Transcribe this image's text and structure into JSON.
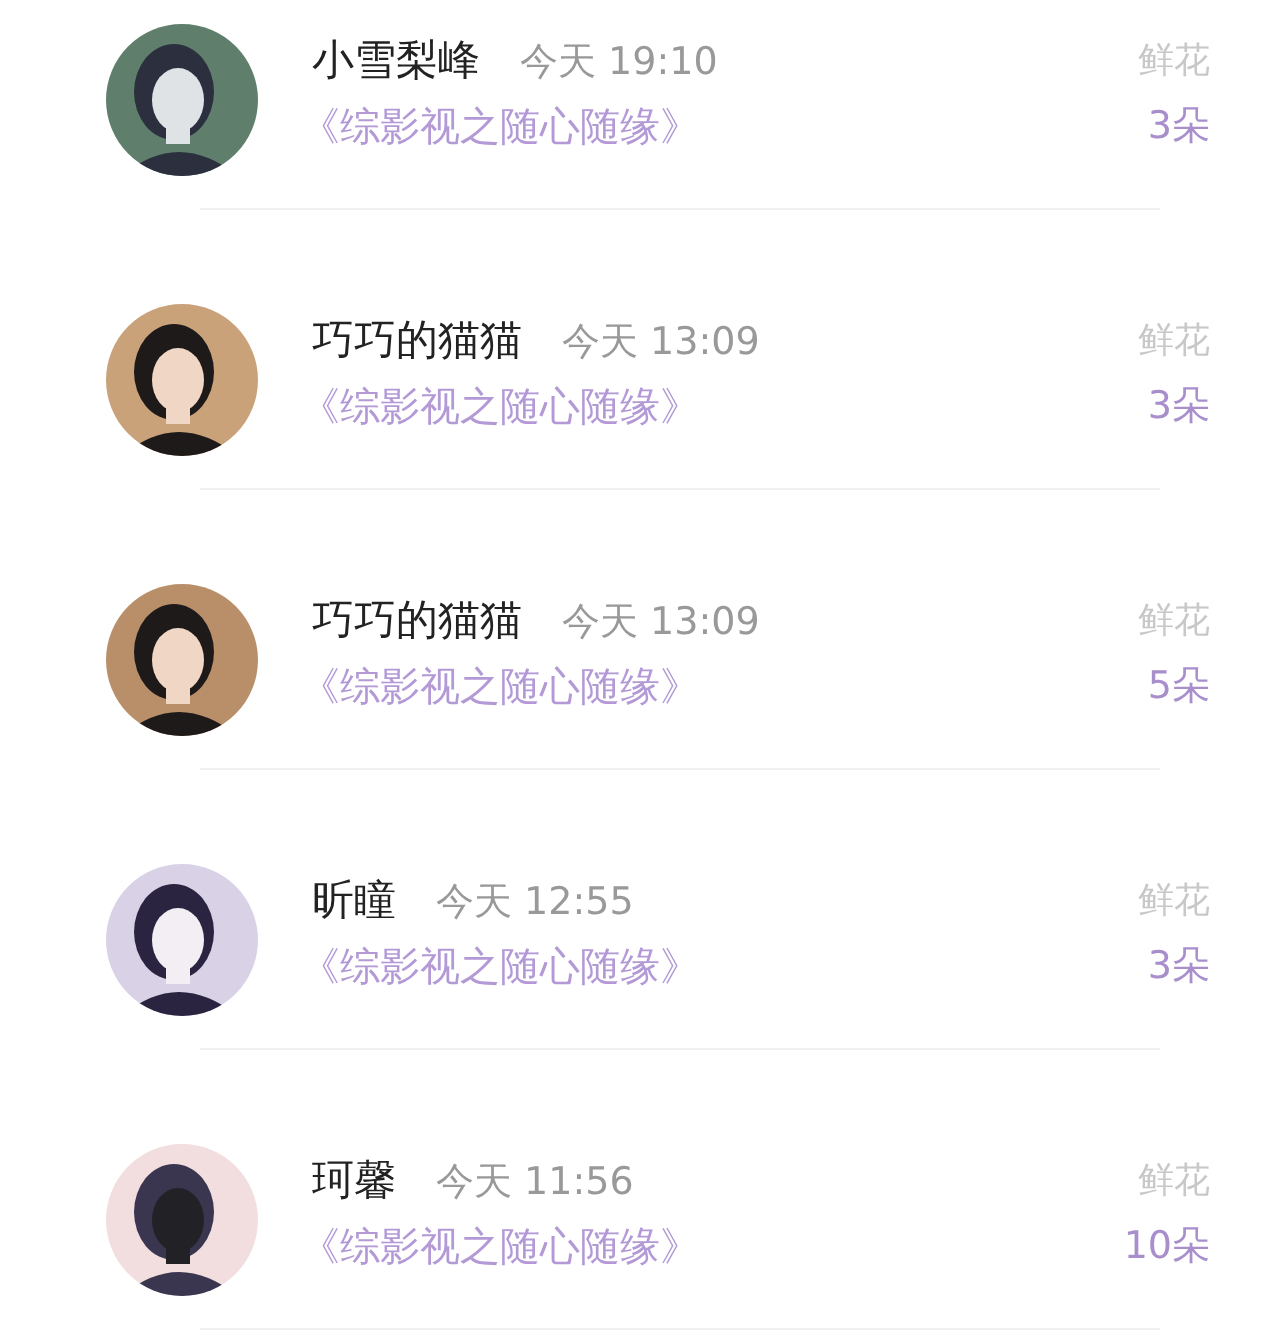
{
  "records": [
    {
      "name": "小雪梨峰",
      "time": "今天 19:10",
      "book": "《综影视之随心随缘》",
      "gift": "鲜花",
      "count": "3朵"
    },
    {
      "name": "巧巧的猫猫",
      "time": "今天 13:09",
      "book": "《综影视之随心随缘》",
      "gift": "鲜花",
      "count": "3朵"
    },
    {
      "name": "巧巧的猫猫",
      "time": "今天 13:09",
      "book": "《综影视之随心随缘》",
      "gift": "鲜花",
      "count": "5朵"
    },
    {
      "name": "昕瞳",
      "time": "今天 12:55",
      "book": "《综影视之随心随缘》",
      "gift": "鲜花",
      "count": "3朵"
    },
    {
      "name": "珂馨",
      "time": "今天 11:56",
      "book": "《综影视之随心随缘》",
      "gift": "鲜花",
      "count": "10朵"
    }
  ]
}
